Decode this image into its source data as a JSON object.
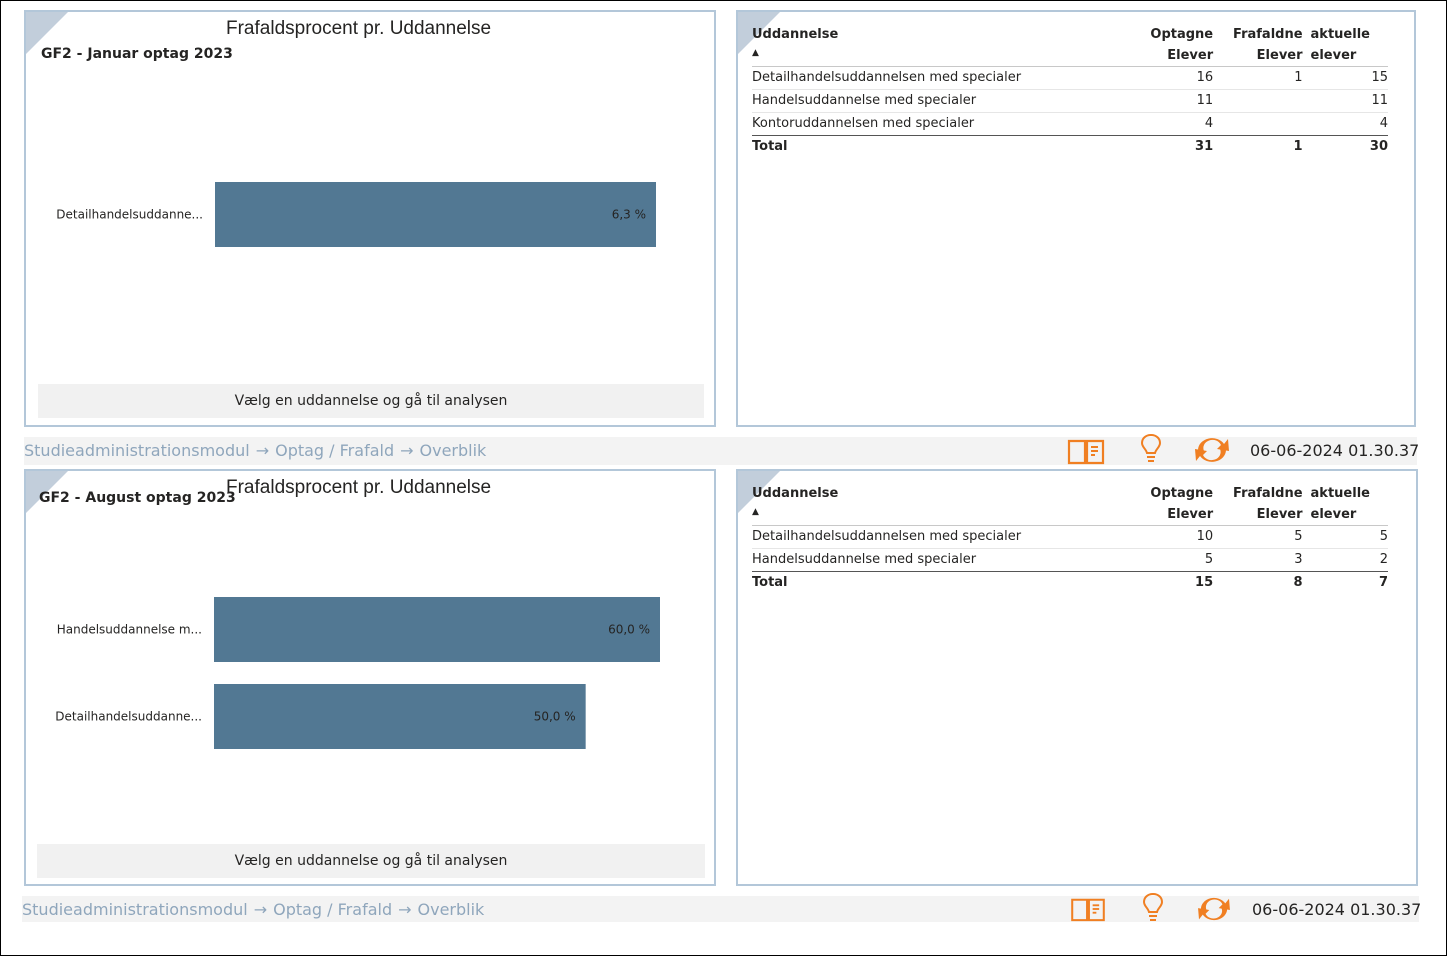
{
  "colors": {
    "bar": "#527893",
    "panel_border": "#b3c7d9",
    "accent_icon": "#f07f22",
    "breadcrumb": "#8fa6bc"
  },
  "sections": [
    {
      "chart": {
        "title": "Frafaldsprocent pr. Uddannelse",
        "subtitle": "GF2 - Januar optag 2023",
        "button_label": "Vælg en uddannelse og gå til analysen",
        "chart_data": {
          "type": "bar",
          "orientation": "horizontal",
          "title": "Frafaldsprocent pr. Uddannelse",
          "categories": [
            "Detailhandelsuddanne..."
          ],
          "values": [
            6.3
          ],
          "value_labels": [
            "6,3 %"
          ]
        }
      },
      "table": {
        "headers": [
          {
            "line1": "Uddannelse",
            "line2": "",
            "sort": "▲"
          },
          {
            "line1": "Optagne",
            "line2": "Elever"
          },
          {
            "line1": "Frafaldne",
            "line2": "Elever"
          },
          {
            "line1": "aktuelle",
            "line2": "elever"
          }
        ],
        "rows": [
          [
            "Detailhandelsuddannelsen med specialer",
            "16",
            "1",
            "15"
          ],
          [
            "Handelsuddannelse med specialer",
            "11",
            "",
            "11"
          ],
          [
            "Kontoruddannelsen med specialer",
            "4",
            "",
            "4"
          ]
        ],
        "total": [
          "Total",
          "31",
          "1",
          "30"
        ]
      },
      "footer": {
        "breadcrumbs": [
          "Studieadministrationsmodul",
          "Optag / Frafald",
          "Overblik"
        ],
        "timestamp": "06-06-2024 01.30.37"
      }
    },
    {
      "chart": {
        "title": "Frafaldsprocent pr. Uddannelse",
        "subtitle": "GF2 - August optag 2023",
        "button_label": "Vælg en uddannelse og gå til analysen",
        "chart_data": {
          "type": "bar",
          "orientation": "horizontal",
          "title": "Frafaldsprocent pr. Uddannelse",
          "categories": [
            "Handelsuddannelse m...",
            "Detailhandelsuddanne..."
          ],
          "values": [
            60.0,
            50.0
          ],
          "value_labels": [
            "60,0 %",
            "50,0 %"
          ]
        }
      },
      "table": {
        "headers": [
          {
            "line1": "Uddannelse",
            "line2": "",
            "sort": "▲"
          },
          {
            "line1": "Optagne",
            "line2": "Elever"
          },
          {
            "line1": "Frafaldne",
            "line2": "Elever"
          },
          {
            "line1": "aktuelle",
            "line2": "elever"
          }
        ],
        "rows": [
          [
            "Detailhandelsuddannelsen med specialer",
            "10",
            "5",
            "5"
          ],
          [
            "Handelsuddannelse med specialer",
            "5",
            "3",
            "2"
          ]
        ],
        "total": [
          "Total",
          "15",
          "8",
          "7"
        ]
      },
      "footer": {
        "breadcrumbs": [
          "Studieadministrationsmodul",
          "Optag / Frafald",
          "Overblik"
        ],
        "timestamp": "06-06-2024 01.30.37"
      }
    }
  ]
}
